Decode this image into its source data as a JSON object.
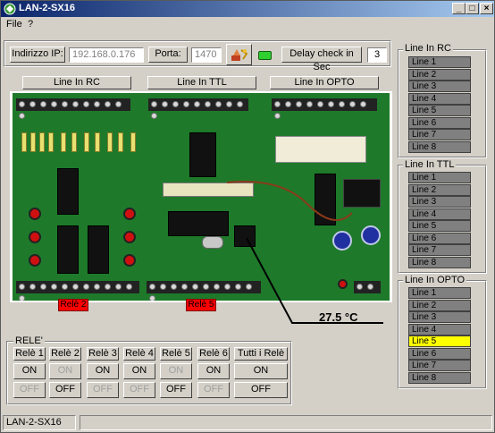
{
  "window": {
    "title": "LAN-2-SX16"
  },
  "menu": [
    "File",
    "?"
  ],
  "connection": {
    "ip_label": "Indirizzo IP:",
    "ip_value": "192.168.0.176",
    "port_label": "Porta:",
    "port_value": "1470",
    "delay_label": "Delay check in Sec",
    "delay_value": "3"
  },
  "section_tabs": [
    "Line In RC",
    "Line In TTL",
    "Line In OPTO"
  ],
  "board": {
    "relay_labels": [
      "Relè 2",
      "Relè 5"
    ],
    "temperature": "27.5 °C"
  },
  "panels": [
    {
      "title": "Line In RC",
      "lines": [
        "Line 1",
        "Line 2",
        "Line 3",
        "Line 4",
        "Line 5",
        "Line 6",
        "Line 7",
        "Line 8"
      ],
      "active": []
    },
    {
      "title": "Line In TTL",
      "lines": [
        "Line 1",
        "Line 2",
        "Line 3",
        "Line 4",
        "Line 5",
        "Line 6",
        "Line 7",
        "Line 8"
      ],
      "active": []
    },
    {
      "title": "Line In OPTO",
      "lines": [
        "Line 1",
        "Line 2",
        "Line 3",
        "Line 4",
        "Line 5",
        "Line 6",
        "Line 7",
        "Line 8"
      ],
      "active": [
        5
      ]
    }
  ],
  "relays": {
    "title": "RELE'",
    "columns": [
      {
        "label": "Relè 1",
        "on": "ON",
        "off": "OFF",
        "on_enabled": true,
        "off_enabled": false
      },
      {
        "label": "Relè 2",
        "on": "ON",
        "off": "OFF",
        "on_enabled": false,
        "off_enabled": true
      },
      {
        "label": "Relè 3",
        "on": "ON",
        "off": "OFF",
        "on_enabled": true,
        "off_enabled": false
      },
      {
        "label": "Relè 4",
        "on": "ON",
        "off": "OFF",
        "on_enabled": true,
        "off_enabled": false
      },
      {
        "label": "Relè 5",
        "on": "ON",
        "off": "OFF",
        "on_enabled": false,
        "off_enabled": true
      },
      {
        "label": "Relè 6",
        "on": "ON",
        "off": "OFF",
        "on_enabled": true,
        "off_enabled": false
      }
    ],
    "all": {
      "label": "Tutti i Relè",
      "on": "ON",
      "off": "OFF"
    }
  },
  "statusbar": {
    "text": "LAN-2-SX16"
  },
  "colors": {
    "active_line": "#ffff00",
    "inactive_line": "#808080",
    "relay_on_badge": "#ff0000",
    "board_green": "#1e7a2a"
  }
}
